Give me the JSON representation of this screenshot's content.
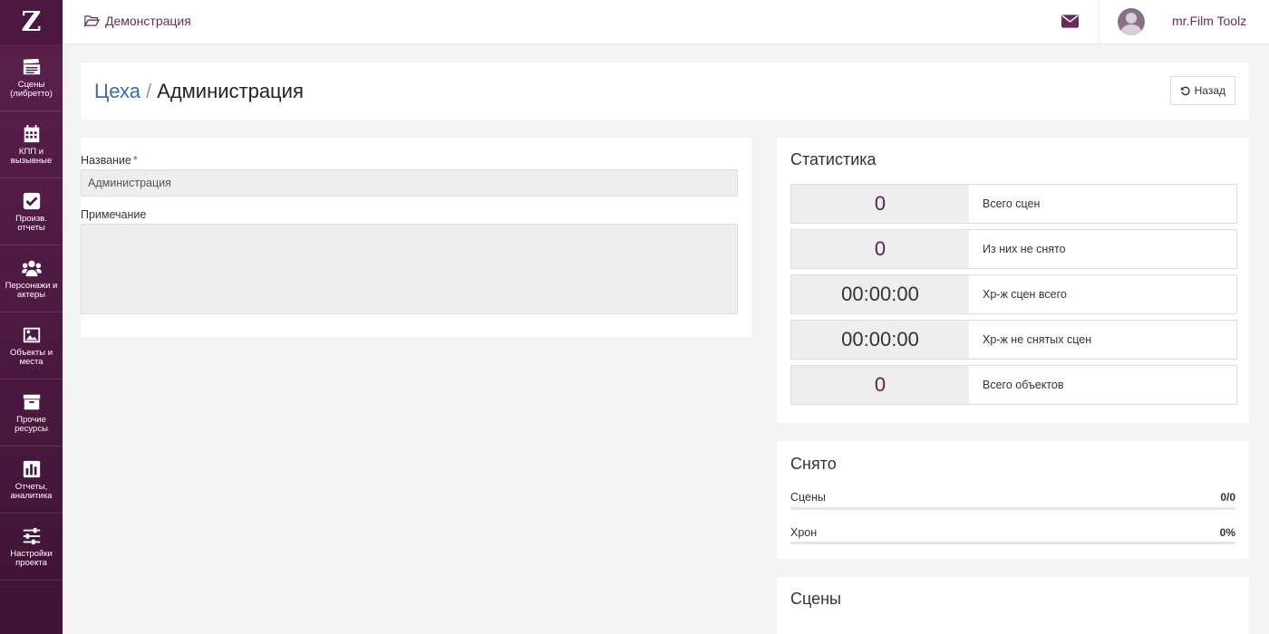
{
  "app": {
    "logo": "Z"
  },
  "sidebar": {
    "items": [
      {
        "label": "Сцены\n(либретто)",
        "icon": "clapperboard-icon"
      },
      {
        "label": "КПП и\nвызывные",
        "icon": "calendar-icon"
      },
      {
        "label": "Произв.\nотчеты",
        "icon": "check-square-icon"
      },
      {
        "label": "Персонажи и\nактеры",
        "icon": "users-icon"
      },
      {
        "label": "Объекты и\nместа",
        "icon": "image-icon"
      },
      {
        "label": "Прочие\nресурсы",
        "icon": "archive-icon"
      },
      {
        "label": "Отчеты,\nаналитика",
        "icon": "bar-chart-icon"
      },
      {
        "label": "Настройки\nпроекта",
        "icon": "sliders-icon"
      }
    ]
  },
  "topbar": {
    "project": "Демонстрация",
    "username": "mr.Film Toolz"
  },
  "header": {
    "breadcrumb_link": "Цеха",
    "separator": "/",
    "current": "Администрация",
    "back_label": "Назад"
  },
  "form": {
    "name_label": "Название",
    "required_mark": "*",
    "name_value": "Администрация",
    "note_label": "Примечание",
    "note_value": ""
  },
  "stats": {
    "title": "Статистика",
    "rows": [
      {
        "value": "0",
        "label": "Всего сцен"
      },
      {
        "value": "0",
        "label": "Из них не снято"
      },
      {
        "value": "00:00:00",
        "label": "Хр-ж сцен всего"
      },
      {
        "value": "00:00:00",
        "label": "Хр-ж не снятых сцен"
      },
      {
        "value": "0",
        "label": "Всего объектов"
      }
    ]
  },
  "shot": {
    "title": "Снято",
    "rows": [
      {
        "label": "Сцены",
        "value": "0/0",
        "progress": 0
      },
      {
        "label": "Хрон",
        "value": "0%",
        "progress": 0
      }
    ]
  },
  "scenes": {
    "title": "Сцены"
  },
  "colors": {
    "accent": "#5a1f4b",
    "link": "#3b6cb3",
    "brand_text": "#6b2a5e"
  }
}
